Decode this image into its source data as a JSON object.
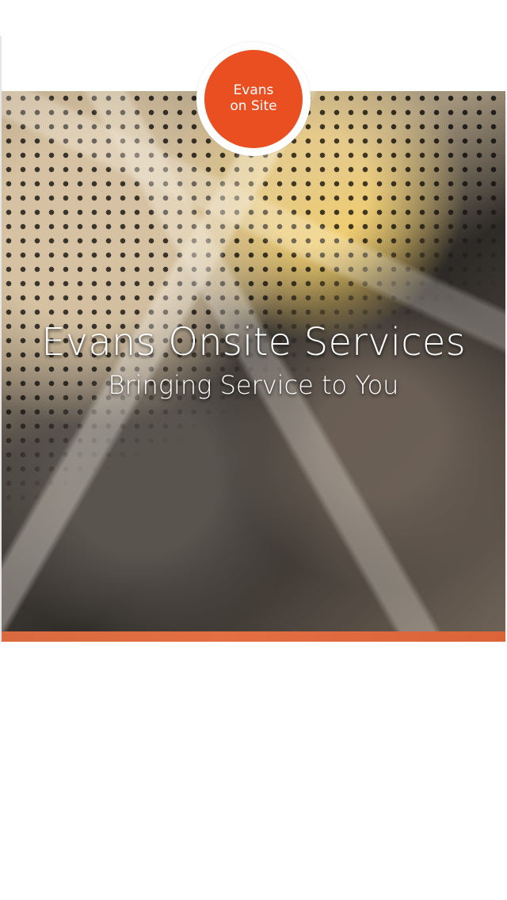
{
  "logo": {
    "line1": "Evans",
    "line2": "on Site"
  },
  "hero": {
    "title": "Evans Onsite Services",
    "subtitle": "Bringing Service to You"
  },
  "colors": {
    "accent": "#ea4f22",
    "band": "#e46f43",
    "background": "#ffffff"
  }
}
